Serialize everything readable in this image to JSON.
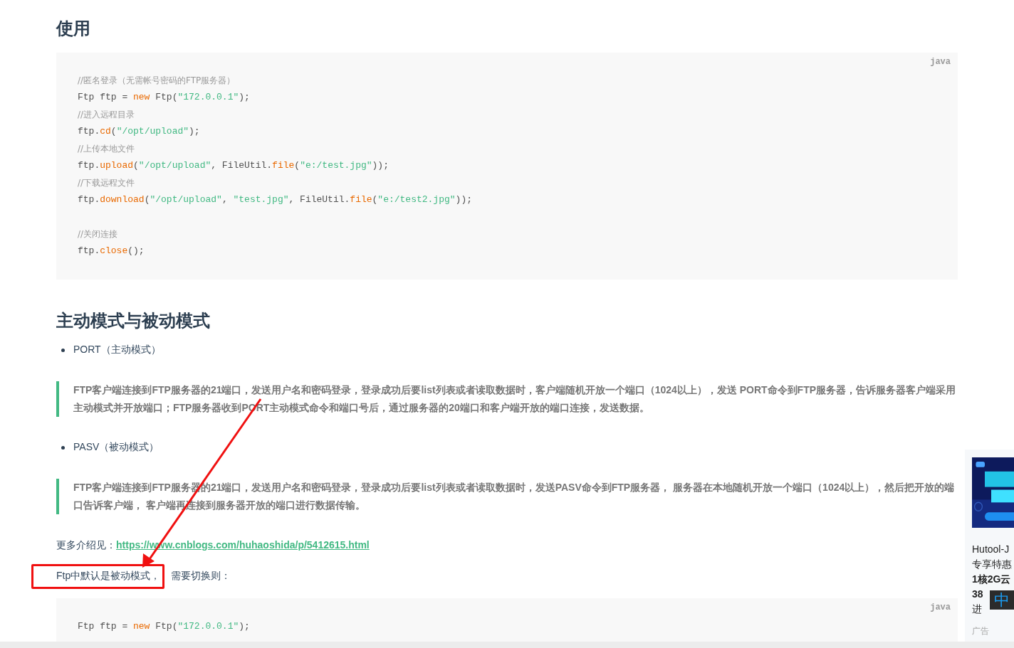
{
  "heading_usage": "使用",
  "code_block_1": {
    "language": "java",
    "lines": [
      {
        "tokens": [
          {
            "kind": "comment",
            "text": "//匿名登录（无需帐号密码的FTP服务器）"
          }
        ]
      },
      {
        "tokens": [
          {
            "kind": "plain",
            "text": "Ftp ftp = "
          },
          {
            "kind": "keyword",
            "text": "new"
          },
          {
            "kind": "plain",
            "text": " Ftp("
          },
          {
            "kind": "string",
            "text": "\"172.0.0.1\""
          },
          {
            "kind": "plain",
            "text": ");"
          }
        ]
      },
      {
        "tokens": [
          {
            "kind": "comment",
            "text": "//进入远程目录"
          }
        ]
      },
      {
        "tokens": [
          {
            "kind": "plain",
            "text": "ftp."
          },
          {
            "kind": "method",
            "text": "cd"
          },
          {
            "kind": "plain",
            "text": "("
          },
          {
            "kind": "string",
            "text": "\"/opt/upload\""
          },
          {
            "kind": "plain",
            "text": ");"
          }
        ]
      },
      {
        "tokens": [
          {
            "kind": "comment",
            "text": "//上传本地文件"
          }
        ]
      },
      {
        "tokens": [
          {
            "kind": "plain",
            "text": "ftp."
          },
          {
            "kind": "method",
            "text": "upload"
          },
          {
            "kind": "plain",
            "text": "("
          },
          {
            "kind": "string",
            "text": "\"/opt/upload\""
          },
          {
            "kind": "plain",
            "text": ", FileUtil."
          },
          {
            "kind": "method",
            "text": "file"
          },
          {
            "kind": "plain",
            "text": "("
          },
          {
            "kind": "string",
            "text": "\"e:/test.jpg\""
          },
          {
            "kind": "plain",
            "text": "));"
          }
        ]
      },
      {
        "tokens": [
          {
            "kind": "comment",
            "text": "//下载远程文件"
          }
        ]
      },
      {
        "tokens": [
          {
            "kind": "plain",
            "text": "ftp."
          },
          {
            "kind": "method",
            "text": "download"
          },
          {
            "kind": "plain",
            "text": "("
          },
          {
            "kind": "string",
            "text": "\"/opt/upload\""
          },
          {
            "kind": "plain",
            "text": ", "
          },
          {
            "kind": "string",
            "text": "\"test.jpg\""
          },
          {
            "kind": "plain",
            "text": ", FileUtil."
          },
          {
            "kind": "method",
            "text": "file"
          },
          {
            "kind": "plain",
            "text": "("
          },
          {
            "kind": "string",
            "text": "\"e:/test2.jpg\""
          },
          {
            "kind": "plain",
            "text": "));"
          }
        ]
      },
      {
        "kind": "blank"
      },
      {
        "tokens": [
          {
            "kind": "comment",
            "text": "//关闭连接"
          }
        ]
      },
      {
        "tokens": [
          {
            "kind": "plain",
            "text": "ftp."
          },
          {
            "kind": "method",
            "text": "close"
          },
          {
            "kind": "plain",
            "text": "();"
          }
        ]
      }
    ]
  },
  "heading_modes": "主动模式与被动模式",
  "modes": [
    {
      "bullet": "PORT（主动模式）",
      "quote": "FTP客户端连接到FTP服务器的21端口，发送用户名和密码登录，登录成功后要list列表或者读取数据时，客户端随机开放一个端口（1024以上），发送 PORT命令到FTP服务器，告诉服务器客户端采用主动模式并开放端口；FTP服务器收到PORT主动模式命令和端口号后，通过服务器的20端口和客户端开放的端口连接，发送数据。"
    },
    {
      "bullet": "PASV（被动模式）",
      "quote": "FTP客户端连接到FTP服务器的21端口，发送用户名和密码登录，登录成功后要list列表或者读取数据时，发送PASV命令到FTP服务器， 服务器在本地随机开放一个端口（1024以上），然后把开放的端口告诉客户端， 客户端再连接到服务器开放的端口进行数据传输。"
    }
  ],
  "more_info": {
    "label": "更多介绍见：",
    "link": "https://www.cnblogs.com/huhaoshida/p/5412615.html"
  },
  "note": {
    "highlighted": "Ftp中默认是被动模式，",
    "rest": "需要切换则："
  },
  "code_block_2": {
    "language": "java",
    "lines": [
      {
        "tokens": [
          {
            "kind": "plain",
            "text": "Ftp ftp = "
          },
          {
            "kind": "keyword",
            "text": "new"
          },
          {
            "kind": "plain",
            "text": " Ftp("
          },
          {
            "kind": "string",
            "text": "\"172.0.0.1\""
          },
          {
            "kind": "plain",
            "text": ");"
          }
        ]
      }
    ]
  },
  "ad": {
    "kind": "picture",
    "lines": [
      {
        "text": "Hutool-J",
        "bold": false
      },
      {
        "text": "专享特惠",
        "bold": false
      },
      {
        "text": "1核2G云",
        "bold": true
      },
      {
        "text": "38",
        "bold": true
      },
      {
        "text": "进",
        "bold": false
      }
    ],
    "tag": "广告"
  },
  "ime_indicator": "中"
}
